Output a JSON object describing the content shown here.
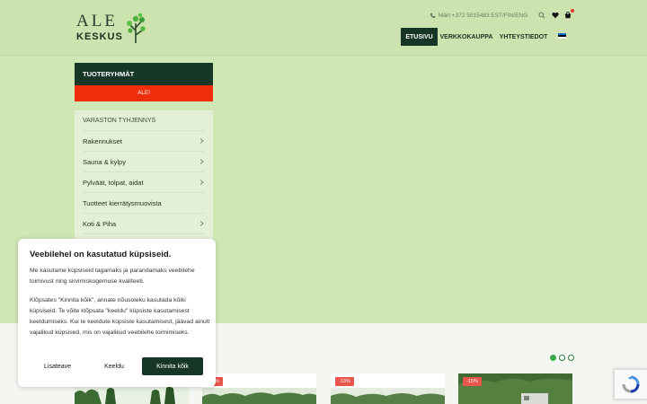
{
  "header": {
    "logo_text_top": "ALE",
    "logo_text_bottom": "KESKUS",
    "contact": "Märt +372 5015483 EST/FIN/ENG",
    "nav": [
      {
        "label": "ETUSIVU",
        "active": true
      },
      {
        "label": "VERKKOKAUPPA",
        "active": false
      },
      {
        "label": "YHTEYSTIEDOT",
        "active": false
      }
    ],
    "icons": [
      "phone-icon",
      "search-icon",
      "heart-icon",
      "cart-icon",
      "estonia-flag-icon"
    ]
  },
  "sidebar": {
    "heading": "TUOTERYHMÄT",
    "sale": "ALE!",
    "items": [
      {
        "label": "VARASTON TYHJENNYS",
        "has_chevron": false
      },
      {
        "label": "Rakennukset",
        "has_chevron": true
      },
      {
        "label": "Sauna & kylpy",
        "has_chevron": true
      },
      {
        "label": "Pylväät, tolpat, aidat",
        "has_chevron": true
      },
      {
        "label": "Tuotteet kierrätysmuovista",
        "has_chevron": false
      },
      {
        "label": "Koti & Piha",
        "has_chevron": true
      }
    ]
  },
  "products": {
    "badges": [
      "",
      "-2%",
      "-13%",
      "-15%"
    ]
  },
  "cookie": {
    "title": "Veebilehel on kasutatud küpsiseid.",
    "paragraph1": "Me kasutame küpsiseid tagamaks ja parandamaks veebilehe toimivust ning sirvimiskogemuse kvaliteeti.",
    "paragraph2": "Klõpsates \"Kinnita kõik\", annate nõusoleku kasutada kõiki küpsiseid. Te võite klõpsata \"keeldu\" küpsiste kasutamisest keeldumiseks. Kui te keeldute küpsiste kasutamisest, jäävad ainult vajalikud küpsised, mis on vajalikud veebilehe toimimiseks.",
    "buttons": {
      "more": "Lisateave",
      "decline": "Keeldu",
      "accept": "Kinnita kõik"
    }
  },
  "colors": {
    "header_bg": "#cce3b0",
    "accent_dark": "#163628",
    "sale_red": "#f02d0a",
    "badge_red": "#e8554b"
  }
}
